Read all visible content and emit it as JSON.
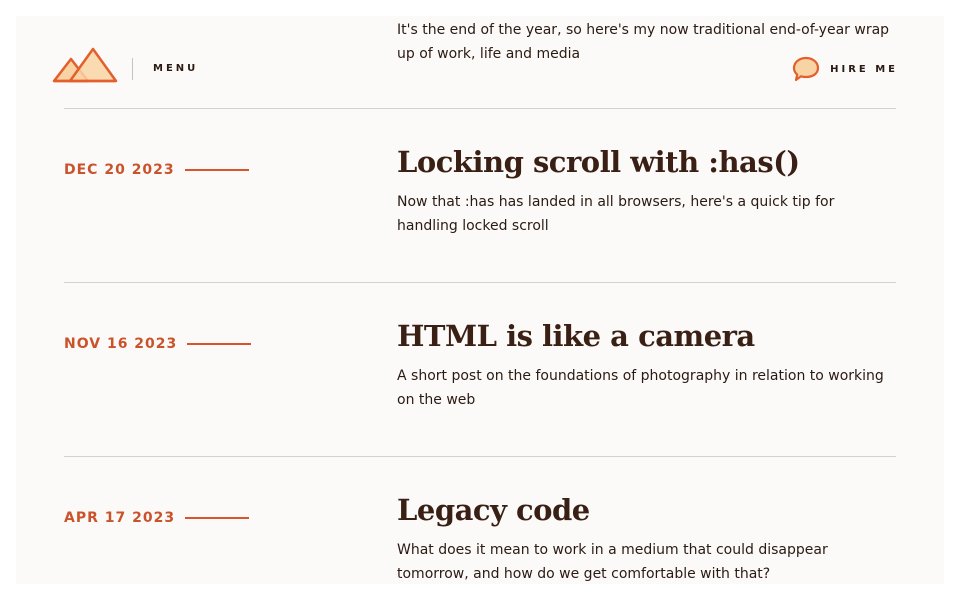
{
  "header": {
    "menu_label": "MENU",
    "hire_label": "HIRE ME"
  },
  "intro": {
    "text": "It's the end of the year, so here's my now traditional end-of-year wrap up of work, life and media"
  },
  "posts": [
    {
      "date": "DEC 20 2023",
      "title": "Locking scroll with :has()",
      "description": "Now that :has has landed in all browsers, here's a quick tip for handling locked scroll"
    },
    {
      "date": "NOV 16 2023",
      "title": "HTML is like a camera",
      "description": "A short post on the foundations of photography in relation to working on the web"
    },
    {
      "date": "APR 17 2023",
      "title": "Legacy code",
      "description": "What does it mean to work in a medium that could disappear tomorrow, and how do we get comfortable with that?"
    }
  ],
  "colors": {
    "accent": "#d9542b",
    "accent_light": "#f8d3a4",
    "page_bg": "#fcfaf9",
    "text": "#2a1a12",
    "title": "#3a1f14"
  },
  "icons": {
    "logo": "mountains-logo",
    "hire": "speech-bubble-icon"
  }
}
